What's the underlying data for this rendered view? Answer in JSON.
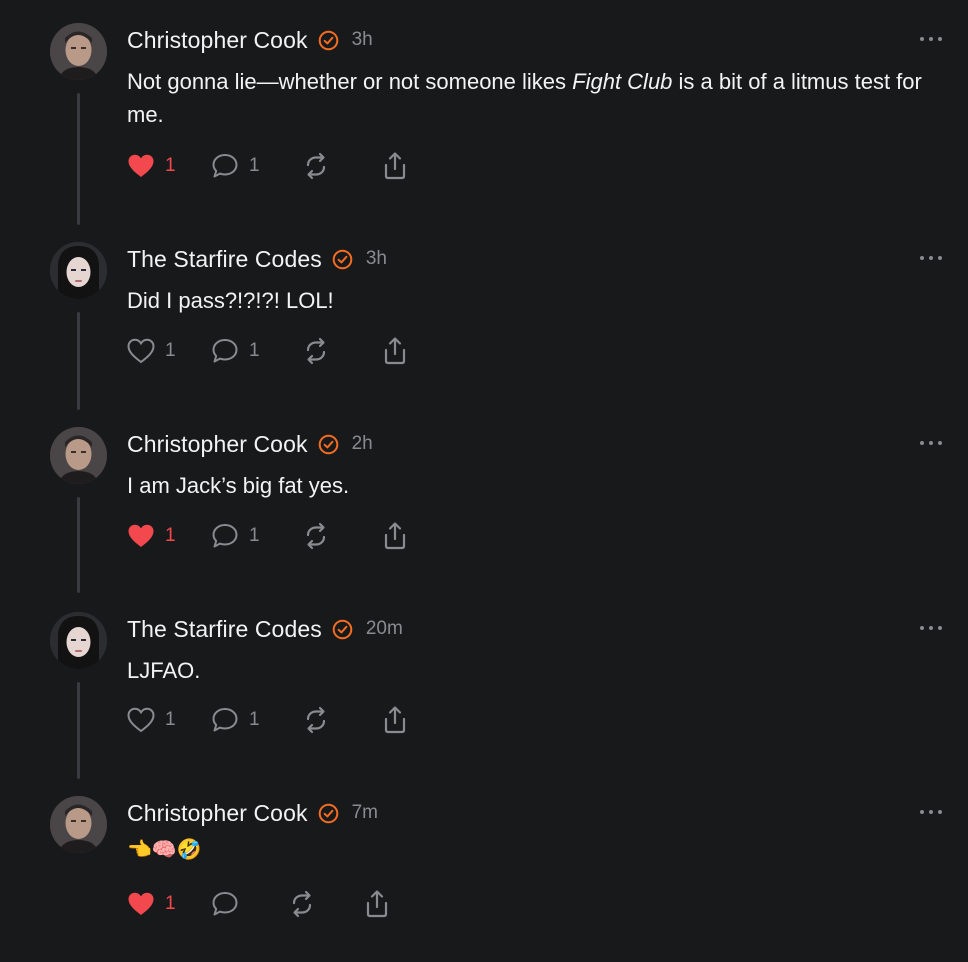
{
  "colors": {
    "background": "#18191b",
    "verified_badge": "#f26d21",
    "like_active": "#f3494e",
    "muted": "#8a8b8e",
    "thread_line": "#3a3b3e"
  },
  "posts": [
    {
      "author": "Christopher Cook",
      "time": "3h",
      "text_before": "Not gonna lie—whether or not someone likes ",
      "text_italic": "Fight Club",
      "text_after": " is a bit of a litmus test for me.",
      "liked": true,
      "like_count": "1",
      "reply_count": "1",
      "avatar_icon": "avatar-christopher-cook"
    },
    {
      "author": "The Starfire Codes",
      "time": "3h",
      "text": "Did I pass?!?!?! LOL!",
      "liked": false,
      "like_count": "1",
      "reply_count": "1",
      "avatar_icon": "avatar-starfire-codes"
    },
    {
      "author": "Christopher Cook",
      "time": "2h",
      "text": "I am Jack’s big fat yes.",
      "liked": true,
      "like_count": "1",
      "reply_count": "1",
      "avatar_icon": "avatar-christopher-cook"
    },
    {
      "author": "The Starfire Codes",
      "time": "20m",
      "text": "LJFAO.",
      "liked": false,
      "like_count": "1",
      "reply_count": "1",
      "avatar_icon": "avatar-starfire-codes"
    },
    {
      "author": "Christopher Cook",
      "time": "7m",
      "text": "👈🧠🤣",
      "liked": true,
      "like_count": "1",
      "reply_count": "",
      "avatar_icon": "avatar-christopher-cook"
    }
  ]
}
